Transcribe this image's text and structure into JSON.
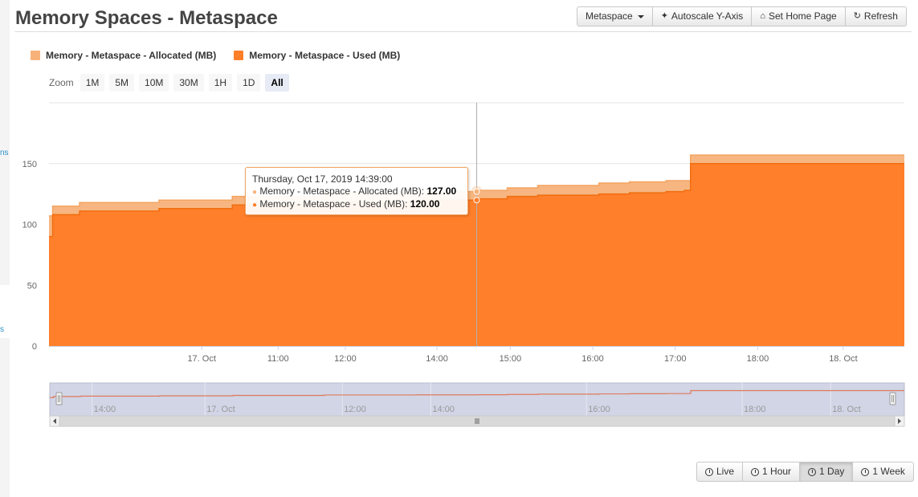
{
  "page": {
    "title": "Memory Spaces - Metaspace"
  },
  "toolbar": {
    "dropdown_label": "Metaspace",
    "autoscale_label": "Autoscale Y-Axis",
    "home_label": "Set Home Page",
    "refresh_label": "Refresh"
  },
  "sidebar": {
    "fragments": [
      "ns",
      "s"
    ]
  },
  "zoom": {
    "label": "Zoom",
    "options": [
      "1M",
      "5M",
      "10M",
      "30M",
      "1H",
      "1D",
      "All"
    ],
    "selected": "All"
  },
  "range_buttons": {
    "items": [
      "Live",
      "1 Hour",
      "1 Day",
      "1 Week"
    ],
    "selected": "1 Day"
  },
  "tooltip": {
    "header": "Thursday, Oct 17, 2019 14:39:00",
    "allocated_label": "Memory - Metaspace - Allocated (MB):",
    "allocated_value": "127.00",
    "used_label": "Memory - Metaspace - Used (MB):",
    "used_value": "120.00"
  },
  "chart_data": {
    "type": "area",
    "series": [
      {
        "name": "Memory - Metaspace - Allocated (MB)",
        "color": "#f7b27a",
        "points": [
          [
            0,
            107
          ],
          [
            0.6,
            115
          ],
          [
            5,
            118
          ],
          [
            18,
            120
          ],
          [
            30,
            123
          ],
          [
            45,
            126
          ],
          [
            60,
            127
          ],
          [
            66,
            127
          ],
          [
            70,
            128
          ],
          [
            75,
            130
          ],
          [
            80,
            132
          ],
          [
            90,
            134
          ],
          [
            95,
            135
          ],
          [
            101,
            136
          ],
          [
            105,
            157
          ],
          [
            140,
            157
          ]
        ]
      },
      {
        "name": "Memory - Metaspace - Used (MB)",
        "color": "#ff7f2a",
        "points": [
          [
            0,
            90
          ],
          [
            0.6,
            108
          ],
          [
            5,
            111
          ],
          [
            18,
            113
          ],
          [
            30,
            116
          ],
          [
            45,
            118
          ],
          [
            60,
            120
          ],
          [
            66,
            120
          ],
          [
            70,
            121
          ],
          [
            75,
            123
          ],
          [
            80,
            124
          ],
          [
            90,
            125
          ],
          [
            95,
            126
          ],
          [
            101,
            127
          ],
          [
            104,
            128
          ],
          [
            105,
            150
          ],
          [
            140,
            150
          ]
        ]
      }
    ],
    "y_axis": {
      "min": 0,
      "max": 200,
      "ticks": [
        0,
        50,
        100,
        150
      ]
    },
    "x_axis": {
      "min": 0,
      "max": 140,
      "ticks": [
        {
          "label": "17. Oct",
          "value": 25
        },
        {
          "label": "11:00",
          "value": 37.5
        },
        {
          "label": "12:00",
          "value": 48.5
        },
        {
          "label": "14:00",
          "value": 63.5
        },
        {
          "label": "15:00",
          "value": 75.5
        },
        {
          "label": "16:00",
          "value": 89
        },
        {
          "label": "17:00",
          "value": 102.5
        },
        {
          "label": "18:00",
          "value": 116
        },
        {
          "label": "18. Oct",
          "value": 130
        }
      ]
    },
    "crosshair_x": 70,
    "grid": true,
    "legend": "top-left",
    "navigator": {
      "ticks": [
        {
          "label": "14:00",
          "value": 8.5
        },
        {
          "label": "17. Oct",
          "value": 27
        },
        {
          "label": "12:00",
          "value": 49.5
        },
        {
          "label": "14:00",
          "value": 64
        },
        {
          "label": "16:00",
          "value": 89.5
        },
        {
          "label": "18:00",
          "value": 115
        },
        {
          "label": "18. Oct",
          "value": 129.5
        }
      ]
    }
  },
  "colors": {
    "allocated": "#f7b27a",
    "used": "#ff7f2a",
    "navigator_fill": "#d1d5e6"
  }
}
